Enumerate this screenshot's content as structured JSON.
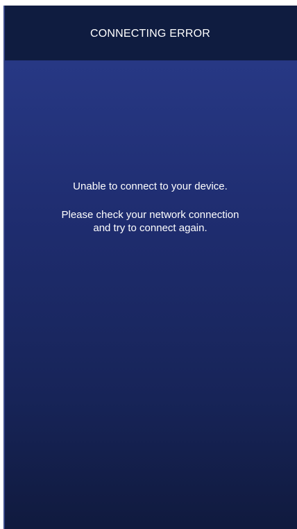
{
  "header": {
    "title": "CONNECTING ERROR"
  },
  "message": {
    "line1": "Unable to connect to your device.",
    "line2": "Please check your network connection",
    "line3": "and try to connect again."
  },
  "colors": {
    "header_bg": "#0f1c40",
    "body_gradient_top": "#2a3c8c",
    "body_gradient_bottom": "#101a3e",
    "text": "#ffffff"
  }
}
